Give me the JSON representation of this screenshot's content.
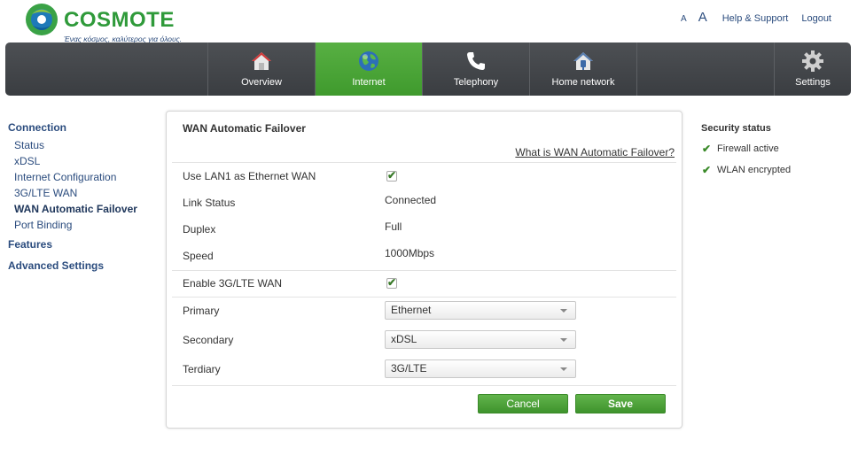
{
  "brand": {
    "name": "COSMOTE",
    "tagline": "Ένας κόσμος, καλύτερος για όλους."
  },
  "toplinks": {
    "font_small": "A",
    "font_large": "A",
    "help": "Help & Support",
    "logout": "Logout"
  },
  "nav": {
    "items": [
      {
        "label": "Overview",
        "icon": "home-icon"
      },
      {
        "label": "Internet",
        "icon": "globe-icon"
      },
      {
        "label": "Telephony",
        "icon": "phone-icon"
      },
      {
        "label": "Home network",
        "icon": "home-network-icon"
      }
    ],
    "settings": {
      "label": "Settings",
      "icon": "gear-icon"
    },
    "active": "Internet"
  },
  "leftnav": {
    "connection": "Connection",
    "subitems": [
      "Status",
      "xDSL",
      "Internet Configuration",
      "3G/LTE WAN",
      "WAN Automatic Failover",
      "Port Binding"
    ],
    "current": "WAN Automatic Failover",
    "features": "Features",
    "advanced": "Advanced Settings"
  },
  "panel": {
    "title": "WAN Automatic Failover",
    "help_link": "What is WAN Automatic Failover?",
    "use_lan1_label": "Use LAN1 as Ethernet WAN",
    "use_lan1_checked": true,
    "link_status_label": "Link Status",
    "link_status_value": "Connected",
    "duplex_label": "Duplex",
    "duplex_value": "Full",
    "speed_label": "Speed",
    "speed_value": "1000Mbps",
    "enable_3g_label": "Enable 3G/LTE WAN",
    "enable_3g_checked": true,
    "primary_label": "Primary",
    "primary_value": "Ethernet",
    "secondary_label": "Secondary",
    "secondary_value": "xDSL",
    "terdiary_label": "Terdiary",
    "terdiary_value": "3G/LTE",
    "cancel": "Cancel",
    "save": "Save"
  },
  "security": {
    "title": "Security status",
    "items": [
      "Firewall active",
      "WLAN encrypted"
    ]
  },
  "colors": {
    "brand_green": "#2f9a3a",
    "nav_active": "#4ea63a",
    "link_blue": "#2b4c7e",
    "navbar_dark": "#434649"
  }
}
